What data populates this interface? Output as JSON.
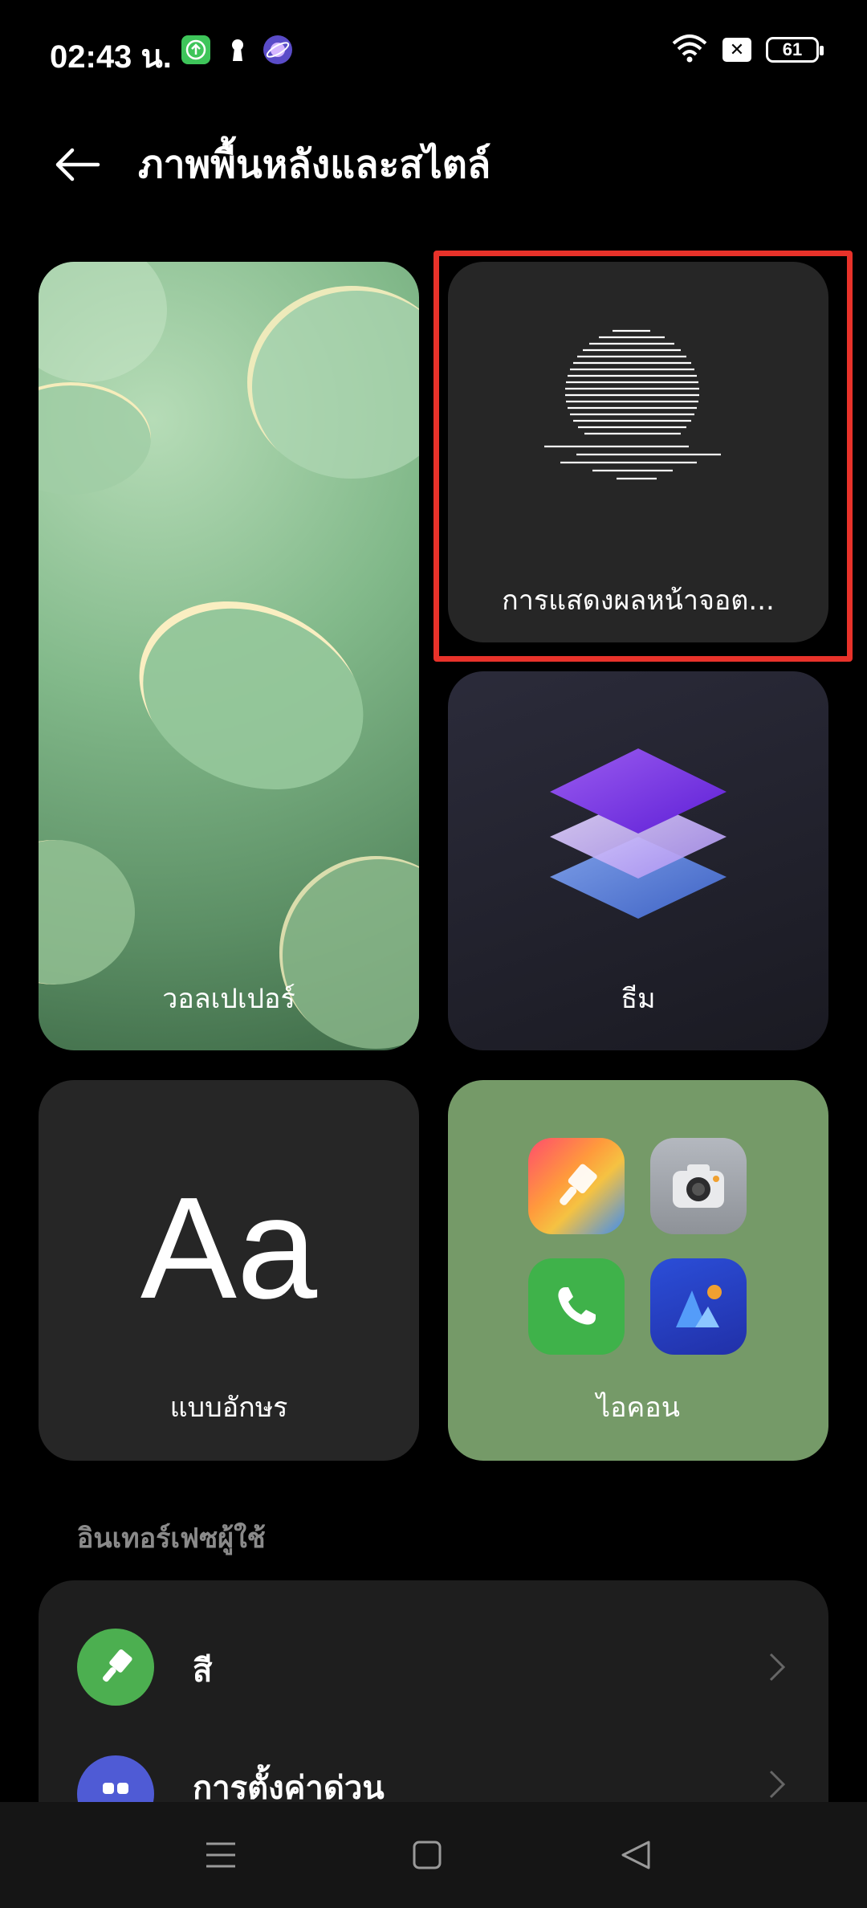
{
  "status_bar": {
    "time": "02:43 น.",
    "battery": "61",
    "icons": [
      "upload-notification-icon",
      "keyhole-icon",
      "orbit-app-icon",
      "wifi-icon",
      "no-sim-icon",
      "battery-icon"
    ]
  },
  "header": {
    "back_icon": "arrow-left-icon",
    "title": "ภาพพื้นหลังและสไตล์"
  },
  "cards": {
    "wallpaper": {
      "label": "วอลเปเปอร์"
    },
    "always_on_display": {
      "label": "การแสดงผลหน้าจอต..."
    },
    "theme": {
      "label": "ธีม"
    },
    "font": {
      "preview": "Aa",
      "label": "แบบอักษร"
    },
    "icons": {
      "label": "ไอคอน",
      "apps": [
        "paintbrush-app-icon",
        "camera-app-icon",
        "phone-app-icon",
        "gallery-app-icon"
      ]
    }
  },
  "section": {
    "title": "อินเทอร์เฟซผู้ใช้",
    "items": [
      {
        "label": "สี",
        "icon": "paintbrush-icon",
        "icon_color": "#4caf50"
      },
      {
        "label": "การตั้งค่าด่วน",
        "icon": "toggles-icon",
        "icon_color": "#4f5bd5"
      }
    ]
  },
  "colors": {
    "background": "#000000",
    "card": "#262626",
    "highlight": "#e8322a",
    "accent_green": "#4caf50"
  },
  "nav_bar": {
    "icons": [
      "menu-icon",
      "home-icon",
      "back-triangle-icon"
    ]
  }
}
